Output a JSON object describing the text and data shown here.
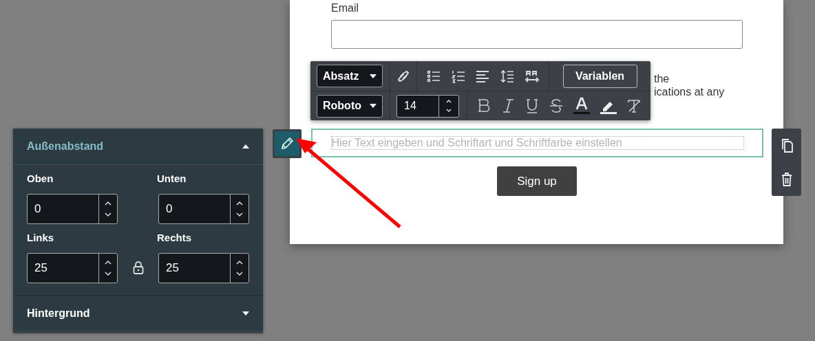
{
  "form": {
    "email_label": "Email",
    "partial_lines": [
      "the",
      "ications at any"
    ],
    "text_block": {
      "placeholder": "Hier Text eingeben und Schriftart und Schriftfarbe einstellen",
      "selected": true
    },
    "submit_button": "Sign up"
  },
  "toolbar": {
    "block_format": "Absatz",
    "font_family": "Roboto",
    "font_size": "14",
    "variables_button": "Variablen"
  },
  "side_panel": {
    "sections": [
      {
        "title": "Außenabstand",
        "expanded": true,
        "fields": [
          {
            "label": "Oben",
            "value": "0"
          },
          {
            "label": "Unten",
            "value": "0"
          },
          {
            "label": "Links",
            "value": "25"
          },
          {
            "label": "Rechts",
            "value": "25"
          }
        ]
      },
      {
        "title": "Hintergrund",
        "expanded": false
      }
    ]
  }
}
